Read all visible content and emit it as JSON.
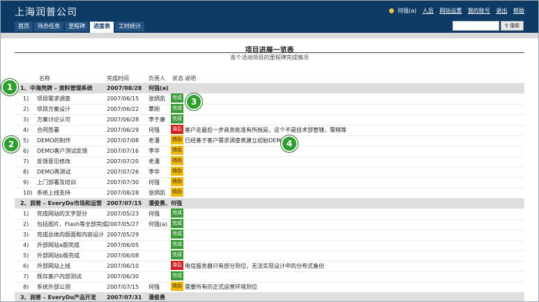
{
  "app": {
    "company": "上海润普公司"
  },
  "toplinks": {
    "user": "何强(a)",
    "people": "人员",
    "settings": "网站设置",
    "account": "我的账号",
    "logout": "退出",
    "help": "帮助"
  },
  "tabs": [
    "首页",
    "待办任务",
    "里程碑",
    "进度表",
    "工时统计"
  ],
  "search": {
    "button": "搜索",
    "value": ""
  },
  "report": {
    "title": "项目进展一览表",
    "subtitle": "各个活动项目的里程碑完成情况"
  },
  "columns": {
    "name": "名称",
    "date": "完成时间",
    "owner": "负责人",
    "status": "状态",
    "note": "说明"
  },
  "status_colors": {
    "完成": "#3a9a36",
    "滞后": "#d21c1c",
    "待办": "#f2b705"
  },
  "rows": [
    {
      "type": "group",
      "num": "1、",
      "name": "中海壳牌 – 资料管理系统",
      "date": "2007/08/28",
      "owner": "何强(a)"
    },
    {
      "num": "1)",
      "name": "项目需求调查",
      "date": "2007/06/15",
      "owner": "张炳凯",
      "status": "完成",
      "note": ""
    },
    {
      "num": "2)",
      "name": "项目方案设计",
      "date": "2007/06/22",
      "owner": "覃刚",
      "status": "完成",
      "note": ""
    },
    {
      "num": "3)",
      "name": "方案讨论认可",
      "date": "2007/06/28",
      "owner": "李于康",
      "status": "完成",
      "note": ""
    },
    {
      "num": "4)",
      "name": "合同签署",
      "date": "2007/06/29",
      "owner": "何强",
      "status": "滞后",
      "note": "客户走最后一步商务批准有所拖延，这个不是技术部管辖，需稍等"
    },
    {
      "num": "5)",
      "name": "DEMO的制作",
      "date": "2007/07/08",
      "owner": "老潘",
      "status": "待办",
      "note": "已经基于客户需求调查表建立初始DEMO"
    },
    {
      "num": "6)",
      "name": "DEMO客户测试反馈",
      "date": "2007/07/16",
      "owner": "李华",
      "status": "待办",
      "note": ""
    },
    {
      "num": "7)",
      "name": "反馈意见修改",
      "date": "2007/07/20",
      "owner": "老潘",
      "status": "待办",
      "note": ""
    },
    {
      "num": "8)",
      "name": "DEMO再测试",
      "date": "2007/07/26",
      "owner": "李华",
      "status": "待办",
      "note": ""
    },
    {
      "num": "9)",
      "name": "上门部署及培训",
      "date": "2007/07/30",
      "owner": "何强",
      "status": "待办",
      "note": ""
    },
    {
      "num": "10)",
      "name": "系统上线支持",
      "date": "2007/08/28",
      "owner": "张炳凯",
      "status": "待办",
      "note": ""
    },
    {
      "type": "group",
      "num": "2、",
      "name": "润普 – EveryDo市场和运营",
      "date": "2007/07/15",
      "owner": "潘俊勇、何强"
    },
    {
      "num": "1)",
      "name": "完成网站的文字部分",
      "date": "2007/05/23",
      "owner": "何强",
      "status": "完成",
      "note": ""
    },
    {
      "num": "2)",
      "name": "包括图片、Flash等全部完成",
      "date": "2007/05/27",
      "owner": "何强(a)",
      "status": "完成",
      "note": ""
    },
    {
      "num": "3)",
      "name": "完成总体的版面和内容设计",
      "date": "2007/05/29",
      "owner": "",
      "status": "完成",
      "note": ""
    },
    {
      "num": "4)",
      "name": "外部网站a版完成",
      "date": "2007/06/05",
      "owner": "",
      "status": "完成",
      "note": ""
    },
    {
      "num": "5)",
      "name": "外部网站b版完成",
      "date": "2007/06/08",
      "owner": "",
      "status": "完成",
      "note": ""
    },
    {
      "num": "6)",
      "name": "外部网站上线",
      "date": "2007/06/10",
      "owner": "",
      "status": "滞后",
      "note": "电信服务器只有部分到位，无法实现设计中的分布式备份"
    },
    {
      "num": "7)",
      "name": "既存客户内部测试",
      "date": "2007/06/30",
      "owner": "",
      "status": "完成",
      "note": ""
    },
    {
      "num": "8)",
      "name": "系统外部公测",
      "date": "2007/07/15",
      "owner": "何强",
      "status": "待办",
      "note": "需要所有的正式运营环境到位"
    },
    {
      "type": "group",
      "num": "3、",
      "name": "润普 – EveryDo产品开发",
      "date": "2007/07/31",
      "owner": "潘俊勇"
    }
  ],
  "callouts": [
    "1",
    "2",
    "3",
    "4"
  ]
}
